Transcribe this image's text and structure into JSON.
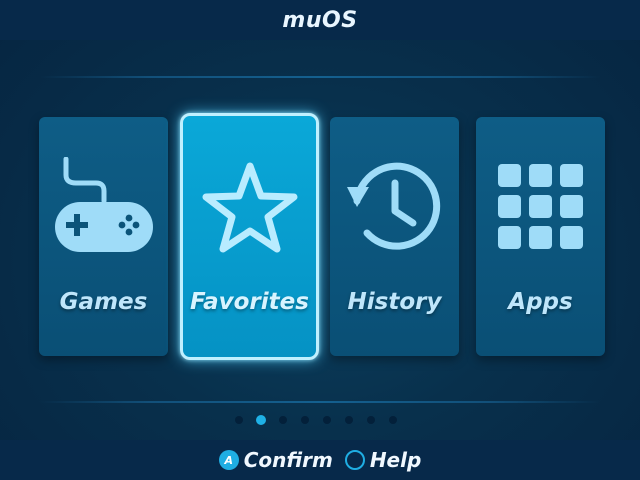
{
  "header": {
    "title": "muOS"
  },
  "menu": {
    "items": [
      {
        "label": "Games",
        "icon": "gamepad-icon"
      },
      {
        "label": "Favorites",
        "icon": "star-icon"
      },
      {
        "label": "History",
        "icon": "history-clock-icon"
      },
      {
        "label": "Apps",
        "icon": "apps-grid-icon"
      }
    ],
    "selected": "Favorites"
  },
  "pager": {
    "count": 8,
    "active": 2
  },
  "footer": {
    "confirm": {
      "button": "A",
      "label": "Confirm"
    },
    "help": {
      "label": "Help"
    }
  },
  "colors": {
    "background": "#08304c",
    "bar": "#07294a",
    "card": "#0a5378",
    "card_selected": "#0aa8d8",
    "accent": "#1faee3",
    "icon": "#9fdcf8"
  }
}
